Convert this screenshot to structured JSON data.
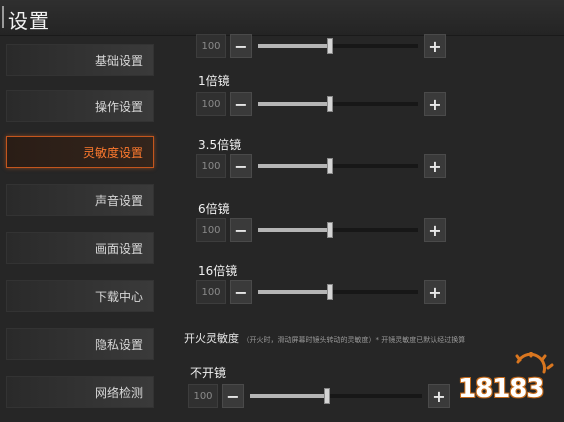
{
  "window": {
    "title": "设置"
  },
  "sidebar": {
    "items": [
      {
        "label": "基础设置",
        "active": false
      },
      {
        "label": "操作设置",
        "active": false
      },
      {
        "label": "灵敏度设置",
        "active": true
      },
      {
        "label": "声音设置",
        "active": false
      },
      {
        "label": "画面设置",
        "active": false
      },
      {
        "label": "下载中心",
        "active": false
      },
      {
        "label": "隐私设置",
        "active": false
      },
      {
        "label": "网络检测",
        "active": false
      }
    ]
  },
  "sensitivity": {
    "top_partial": {
      "value": "100",
      "level": 0.45
    },
    "scopes": [
      {
        "label": "1倍镜",
        "value": "100",
        "level": 0.45
      },
      {
        "label": "3.5倍镜",
        "value": "100",
        "level": 0.45
      },
      {
        "label": "6倍镜",
        "value": "100",
        "level": 0.45
      },
      {
        "label": "16倍镜",
        "value": "100",
        "level": 0.45
      }
    ],
    "fire_section": {
      "title": "开火灵敏度",
      "note": "（开火时，滑动屏幕时镜头转动的灵敏度）* 开镜灵敏度已默认经过换算"
    },
    "no_scope": {
      "label": "不开镜",
      "value": "100",
      "level": 0.45
    }
  },
  "controls": {
    "minus": "−",
    "plus": "+"
  },
  "watermark": {
    "text": "18183",
    "colors": {
      "accent": "#c46a1a"
    }
  },
  "colors": {
    "active_border": "#c4561d",
    "active_text": "#ff7a2e"
  }
}
